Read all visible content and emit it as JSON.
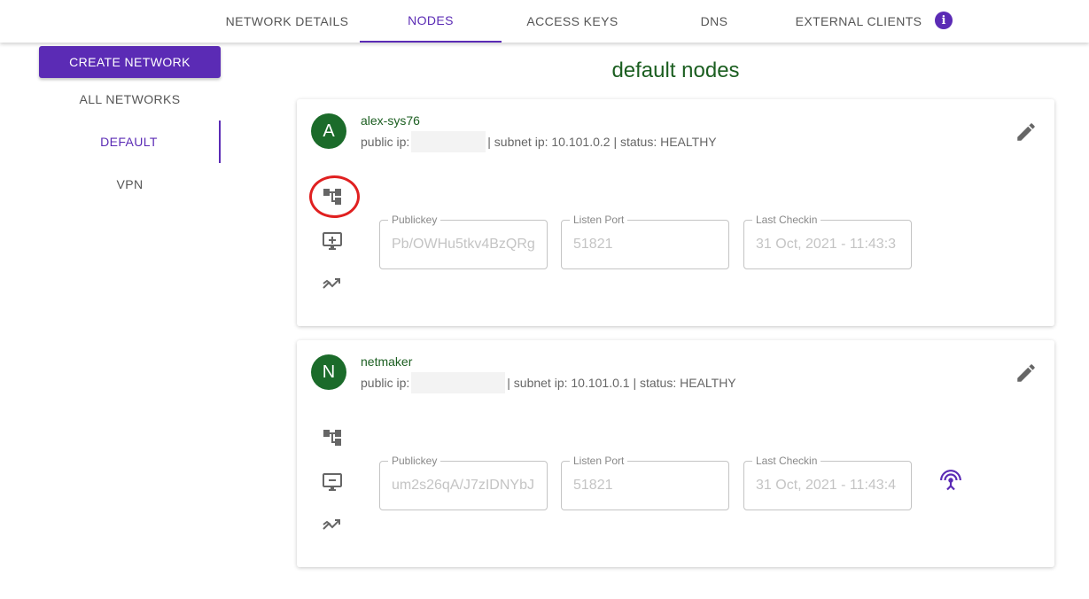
{
  "tabs": [
    {
      "label": "NETWORK DETAILS"
    },
    {
      "label": "NODES"
    },
    {
      "label": "ACCESS KEYS"
    },
    {
      "label": "DNS"
    },
    {
      "label": "EXTERNAL CLIENTS"
    }
  ],
  "info_icon": "i",
  "sidebar": {
    "create_label": "CREATE NETWORK",
    "items": [
      {
        "label": "ALL NETWORKS"
      },
      {
        "label": "DEFAULT"
      },
      {
        "label": "VPN"
      }
    ]
  },
  "page_title": "default nodes",
  "nodes": [
    {
      "avatar": "A",
      "name": "alex-sys76",
      "public_ip_label": "public ip:",
      "details": "| subnet ip: 10.101.0.2 | status: HEALTHY",
      "fields": [
        {
          "label": "Publickey",
          "value": "Pb/OWHu5tkv4BzQRg"
        },
        {
          "label": "Listen Port",
          "value": "51821"
        },
        {
          "label": "Last Checkin",
          "value": "31 Oct, 2021 - 11:43:3"
        }
      ]
    },
    {
      "avatar": "N",
      "name": "netmaker",
      "public_ip_label": "public ip:",
      "details": "| subnet ip: 10.101.0.1 | status: HEALTHY",
      "fields": [
        {
          "label": "Publickey",
          "value": "um2s26qA/J7zIDNYbJ"
        },
        {
          "label": "Listen Port",
          "value": "51821"
        },
        {
          "label": "Last Checkin",
          "value": "31 Oct, 2021 - 11:43:4"
        }
      ]
    }
  ],
  "colors": {
    "accent": "#5b2bb5",
    "title_green": "#1b5e20",
    "avatar_green": "#1b6b2a",
    "highlight_red": "#e02020"
  }
}
